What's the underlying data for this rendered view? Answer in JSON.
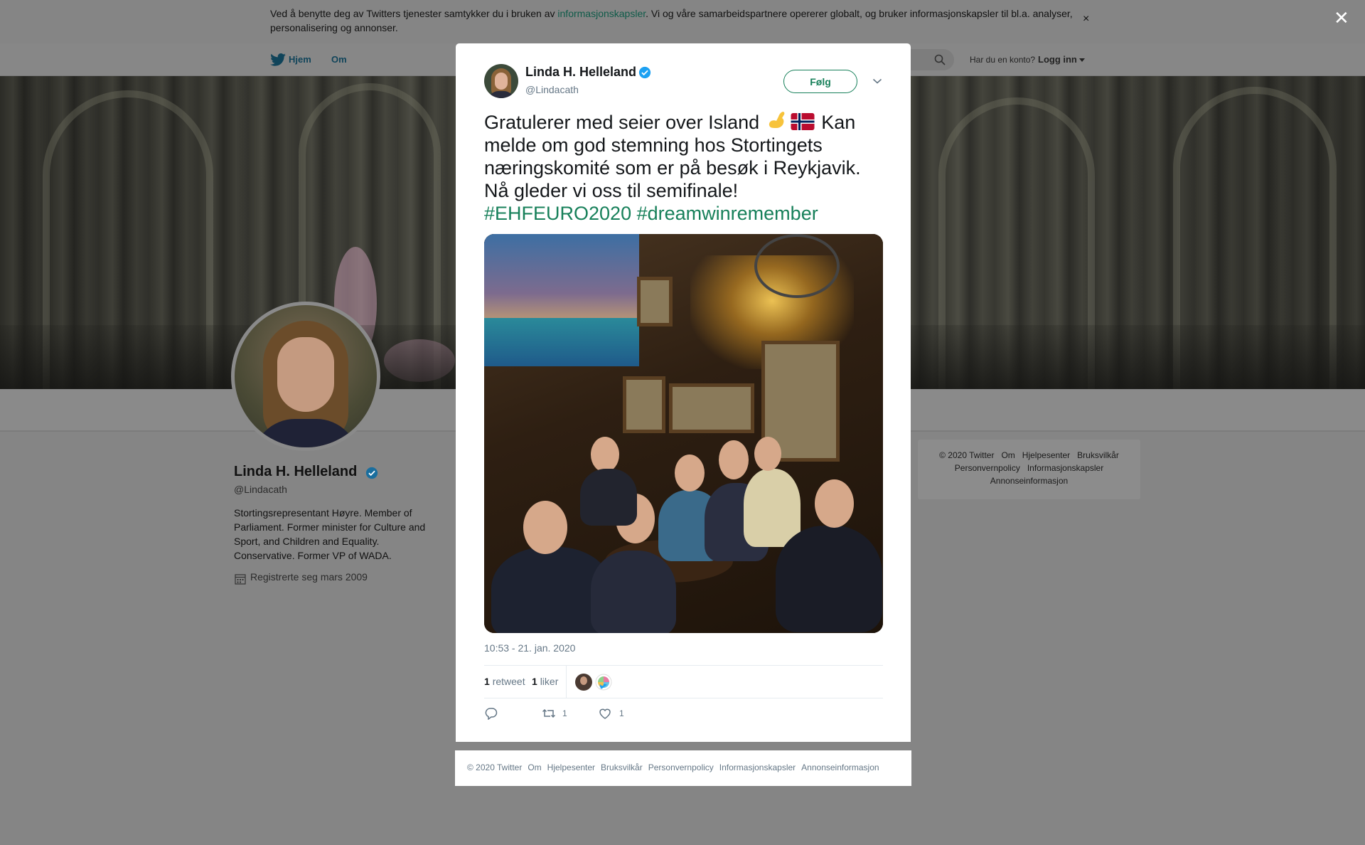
{
  "cookie_banner": {
    "text_before": "Ved å benytte deg av Twitters tjenester samtykker du i bruken av ",
    "link": "informasjonskapsler",
    "text_after": ". Vi og våre samarbeidspartnere opererer globalt, og bruker informasjonskapsler til bl.a. analyser, personalisering og annonser.",
    "close": "×"
  },
  "nav": {
    "home": "Hjem",
    "about": "Om",
    "account_prompt": "Har du en konto?",
    "login": "Logg inn"
  },
  "profile": {
    "name": "Linda H. Helleland",
    "handle": "@Lindacath",
    "bio": "Stortingsrepresentant Høyre. Member of Parliament. Former minister for Culture and Sport, and Children and Equality. Conservative. Former VP of WADA.",
    "joined": "Registrerte seg mars 2009"
  },
  "side_footer": {
    "row1": [
      "© 2020 Twitter",
      "Om",
      "Hjelpesenter",
      "Bruksvilkår"
    ],
    "row2": [
      "Personvernpolicy",
      "Informasjonskapsler"
    ],
    "row3": [
      "Annonseinformasjon"
    ]
  },
  "page_close": "✕",
  "tweet": {
    "author_name": "Linda H. Helleland",
    "author_handle": "@Lindacath",
    "follow_label": "Følg",
    "text_part1": "Gratulerer med seier over Island",
    "text_part2": "Kan melde om god stemning hos Stortingets næringskomité som er på besøk i Reykjavik. Nå gleder vi oss til semifinale!",
    "hashtags": [
      "#EHFEURO2020",
      "#dreamwinremember"
    ],
    "timestamp": "10:53 - 21. jan. 2020",
    "retweets_count": "1",
    "retweets_label": "retweet",
    "likes_count": "1",
    "likes_label": "liker",
    "action_retweet_count": "1",
    "action_like_count": "1"
  },
  "modal_footer": {
    "links": [
      "© 2020 Twitter",
      "Om",
      "Hjelpesenter",
      "Bruksvilkår",
      "Personvernpolicy",
      "Informasjonskapsler",
      "Annonseinformasjon"
    ]
  },
  "colors": {
    "accent": "#17805a",
    "secondary_text": "#657786",
    "verified": "#1da1f2",
    "overlay": "#858585"
  }
}
